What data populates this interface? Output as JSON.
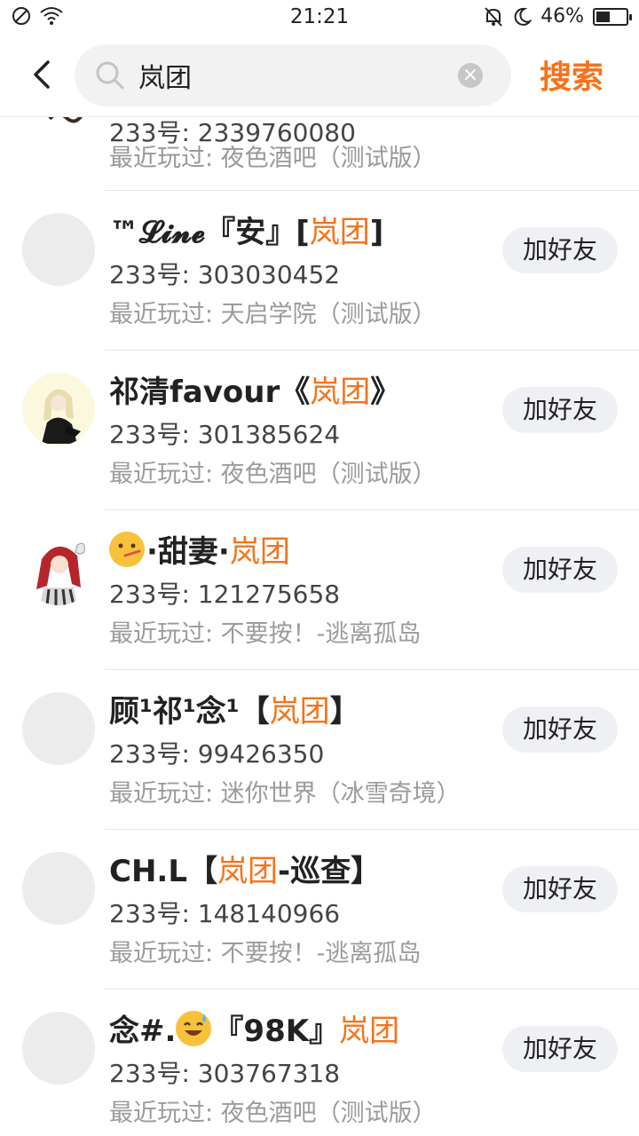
{
  "status_bar": {
    "time": "21:21",
    "battery_text": "46%",
    "battery_level": 0.46
  },
  "header": {
    "search_value": "岚团",
    "search_action": "搜索"
  },
  "partial_item": {
    "uid_fragment": "233号: 2339760080",
    "recent": "最近玩过: 夜色酒吧（测试版）"
  },
  "results": [
    {
      "name_prefix": "™𝓛𝓲𝓷𝓮『安』[",
      "name_highlight": "岚团",
      "name_suffix": "]",
      "uid": "233号: 303030452",
      "recent": "最近玩过: 天启学院（测试版）",
      "add_label": "加好友",
      "avatar": "blank"
    },
    {
      "name_prefix": "祁清favour《",
      "name_highlight": "岚团",
      "name_suffix": "》",
      "uid": "233号: 301385624",
      "recent": "最近玩过: 夜色酒吧（测试版）",
      "add_label": "加好友",
      "avatar": "anime-girl-blonde"
    },
    {
      "name_prefix": "·甜妻·",
      "name_highlight": "岚团",
      "name_suffix": "",
      "uid": "233号: 121275658",
      "recent": "最近玩过: 不要按！-逃离孤岛",
      "add_label": "加好友",
      "avatar": "anime-girl-red"
    },
    {
      "name_prefix": "顾¹祁¹念¹【",
      "name_highlight": "岚团",
      "name_suffix": "】",
      "uid": "233号: 99426350",
      "recent": "最近玩过: 迷你世界（冰雪奇境）",
      "add_label": "加好友",
      "avatar": "blank"
    },
    {
      "name_prefix": "CH.L【",
      "name_highlight": "岚团",
      "name_suffix": "-巡查】",
      "uid": "233号: 148140966",
      "recent": "最近玩过: 不要按！-逃离孤岛",
      "add_label": "加好友",
      "avatar": "blank"
    },
    {
      "name_prefix": "念#.",
      "name_mid": "『98K』",
      "name_highlight": "岚团",
      "name_suffix": "",
      "uid": "233号: 303767318",
      "recent": "最近玩过: 夜色酒吧（测试版）",
      "add_label": "加好友",
      "avatar": "blank"
    }
  ],
  "colors": {
    "accent": "#f5731a",
    "button_bg": "#eef0f4",
    "muted_text": "#9b9b9b"
  }
}
